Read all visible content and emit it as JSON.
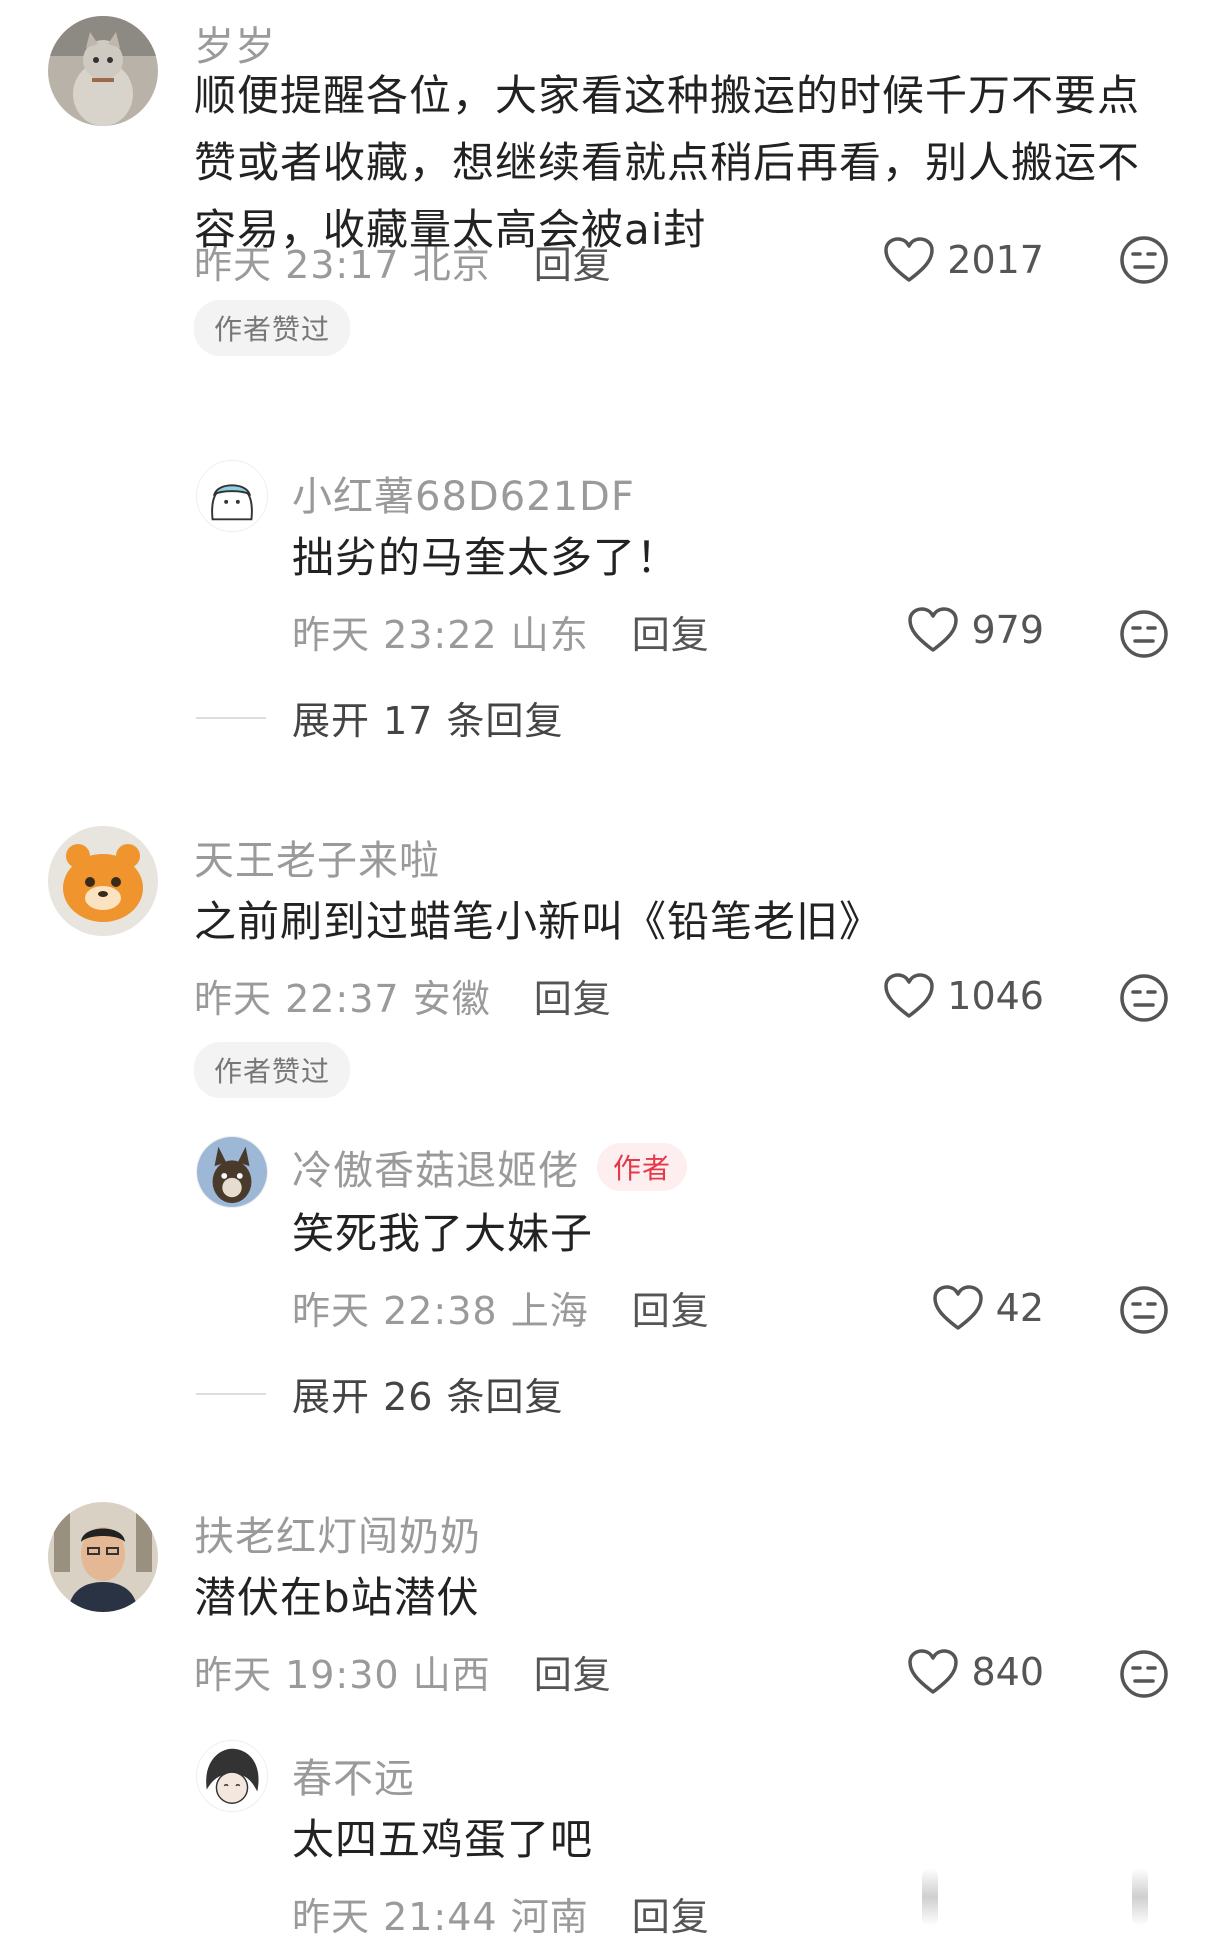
{
  "comments": [
    {
      "username": "岁岁",
      "text": "顺便提醒各位，大家看这种搬运的时候千万不要点赞或者收藏，想继续看就点稍后再看，别人搬运不容易，收藏量太高会被ai封",
      "time": "昨天 23:17",
      "location": "北京",
      "reply_label": "回复",
      "likes": "2017",
      "badge": "作者赞过",
      "reply": {
        "username": "小红薯68D621DF",
        "text": "拙劣的马奎太多了！",
        "time": "昨天 23:22",
        "location": "山东",
        "reply_label": "回复",
        "likes": "979"
      },
      "expand": "展开 17 条回复"
    },
    {
      "username": "天王老子来啦",
      "text": "之前刷到过蜡笔小新叫《铅笔老旧》",
      "time": "昨天 22:37",
      "location": "安徽",
      "reply_label": "回复",
      "likes": "1046",
      "badge": "作者赞过",
      "reply": {
        "username": "冷傲香菇退姬佬",
        "author_tag": "作者",
        "text": "笑死我了大妹子",
        "time": "昨天 22:38",
        "location": "上海",
        "reply_label": "回复",
        "likes": "42"
      },
      "expand": "展开 26 条回复"
    },
    {
      "username": "扶老红灯闯奶奶",
      "text": "潜伏在b站潜伏",
      "time": "昨天 19:30",
      "location": "山西",
      "reply_label": "回复",
      "likes": "840",
      "reply": {
        "username": "春不远",
        "text": "太四五鸡蛋了吧",
        "time": "昨天 21:44",
        "location": "河南",
        "reply_label": "回复"
      }
    }
  ],
  "icons": {
    "like": "heart-icon",
    "dislike": "neutral-face-icon"
  },
  "colors": {
    "author_tag": "#e5394a",
    "secondary_text": "#9a9a9a"
  }
}
